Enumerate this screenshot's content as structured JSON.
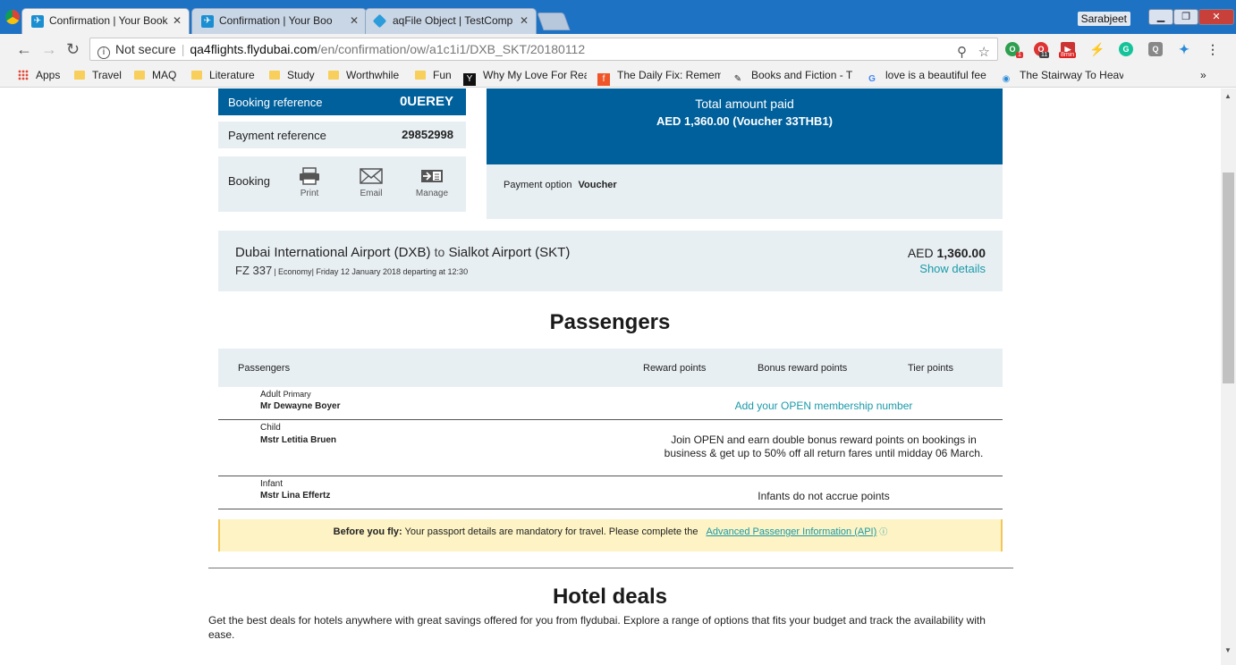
{
  "browser": {
    "tabs": [
      {
        "title": "Confirmation | Your Book"
      },
      {
        "title": "Confirmation | Your Boo"
      },
      {
        "title": "aqFile Object | TestComp"
      }
    ],
    "user": "Sarabjeet",
    "address": {
      "security": "Not secure",
      "domain": "qa4flights.flydubai.com",
      "path": "/en/confirmation/ow/a1c1i1/DXB_SKT/20180112"
    },
    "extension_badges": [
      "1",
      "11",
      "8min"
    ],
    "bookmarks": [
      {
        "label": "Apps",
        "icon": "apps-grid-icon"
      },
      {
        "label": "Travel",
        "icon": "folder-icon"
      },
      {
        "label": "MAQ",
        "icon": "folder-icon"
      },
      {
        "label": "Literature",
        "icon": "folder-icon"
      },
      {
        "label": "Study",
        "icon": "folder-icon"
      },
      {
        "label": "Worthwhile",
        "icon": "folder-icon"
      },
      {
        "label": "Fun",
        "icon": "folder-icon"
      },
      {
        "label": "Why My Love For Rea",
        "icon": "y-icon"
      },
      {
        "label": "The Daily Fix: Remem",
        "icon": "fix-icon"
      },
      {
        "label": "Books and Fiction - T",
        "icon": "pin-icon"
      },
      {
        "label": "love is a beautiful fee",
        "icon": "google-icon"
      },
      {
        "label": "The Stairway To Heav",
        "icon": "location-icon"
      }
    ],
    "overflow": "»"
  },
  "booking": {
    "booking_ref_label": "Booking reference",
    "booking_ref_value": "0UEREY",
    "payment_ref_label": "Payment reference",
    "payment_ref_value": "29852998",
    "booking_label": "Booking",
    "actions": [
      {
        "label": "Print"
      },
      {
        "label": "Email"
      },
      {
        "label": "Manage"
      }
    ]
  },
  "payment": {
    "total_label": "Total amount paid",
    "total_value": "AED 1,360.00 (Voucher 33THB1)",
    "option_label": "Payment option",
    "option_value": "Voucher"
  },
  "flight": {
    "origin": "Dubai International Airport (DXB)",
    "to": "to",
    "destination": "Sialkot Airport (SKT)",
    "number": "FZ 337",
    "cabin": "Economy",
    "date": "Friday 12 January 2018",
    "departing_label": "departing at",
    "time": "12:30",
    "currency": "AED",
    "price": "1,360.00",
    "details_link": "Show details"
  },
  "passengers": {
    "title": "Passengers",
    "headers": [
      "Passengers",
      "Reward points",
      "Bonus reward points",
      "Tier points"
    ],
    "rows": [
      {
        "type": "Adult",
        "tag": "Primary",
        "name": "Mr Dewayne Boyer",
        "message": "Add your OPEN membership number"
      },
      {
        "type": "Child",
        "tag": "",
        "name": "Mstr Letitia Bruen",
        "message": "Join OPEN and earn double bonus reward points on bookings in business & get up to 50% off all return fares until midday 06 March."
      },
      {
        "type": "Infant",
        "tag": "",
        "name": "Mstr Lina Effertz",
        "message": "Infants do not accrue points"
      }
    ]
  },
  "notice": {
    "bold": "Before you fly:",
    "text": "Your passport details are mandatory for travel. Please complete the",
    "link": "Advanced Passenger Information (API)"
  },
  "hotels": {
    "title": "Hotel deals",
    "text": "Get the best deals for hotels anywhere with great savings offered for you from flydubai. Explore a range of options that fits your budget and track the availability with ease."
  }
}
